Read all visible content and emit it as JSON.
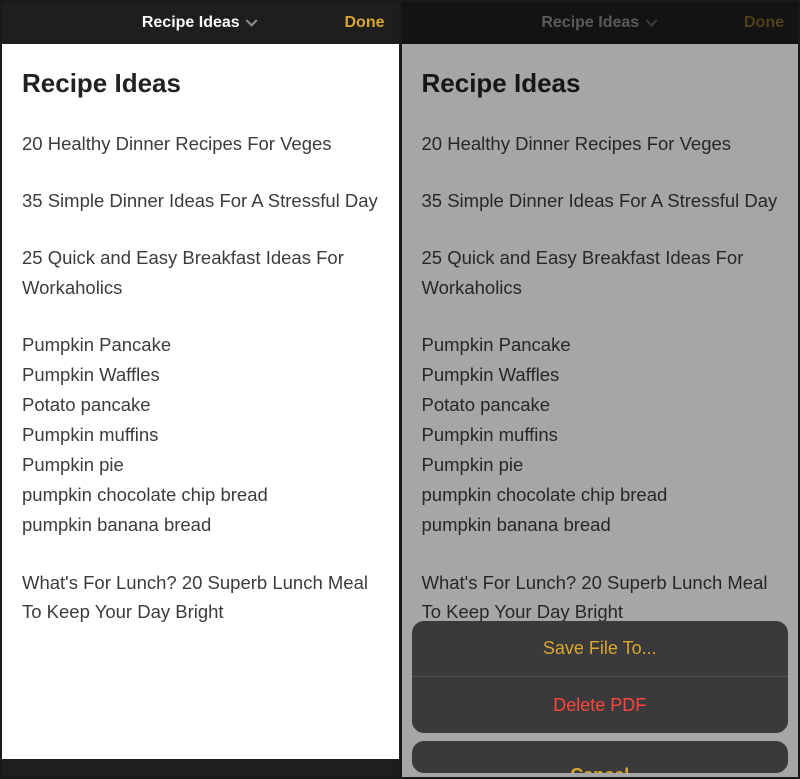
{
  "navbar": {
    "title": "Recipe Ideas",
    "done": "Done"
  },
  "note": {
    "title": "Recipe Ideas",
    "blocks": [
      "20 Healthy Dinner Recipes For Veges",
      "35 Simple Dinner Ideas For A Stressful Day",
      "25 Quick and Easy Breakfast Ideas For Workaholics"
    ],
    "ingredients": [
      "Pumpkin Pancake",
      "Pumpkin Waffles",
      "Potato pancake",
      "Pumpkin muffins",
      "Pumpkin pie",
      "pumpkin chocolate chip bread",
      "pumpkin banana bread"
    ],
    "tail": "What's For Lunch? 20 Superb Lunch Meal To Keep Your Day Bright"
  },
  "actionsheet": {
    "save": "Save File To...",
    "delete": "Delete PDF",
    "cancel": "Cancel"
  }
}
